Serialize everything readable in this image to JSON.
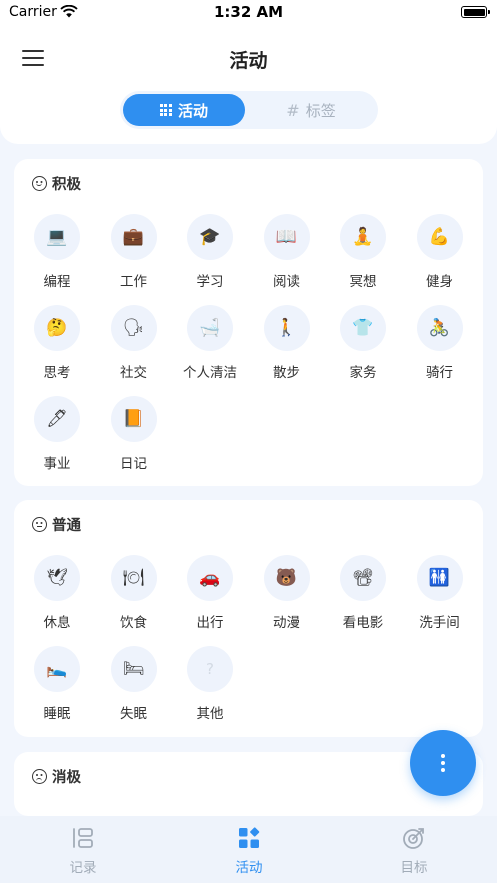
{
  "status_bar": {
    "carrier": "Carrier",
    "time": "1:32 AM"
  },
  "header": {
    "title": "活动",
    "segments": [
      {
        "label": "活动",
        "active": true,
        "icon": "grid-icon"
      },
      {
        "label": "标签",
        "active": false,
        "icon": "hash-icon"
      }
    ]
  },
  "sections": [
    {
      "title": "积极",
      "mood_icon": "smile-face-icon",
      "items": [
        {
          "label": "编程",
          "emoji": "💻",
          "name": "laptop-icon"
        },
        {
          "label": "工作",
          "emoji": "💼",
          "name": "briefcase-icon"
        },
        {
          "label": "学习",
          "emoji": "🎓",
          "name": "graduation-cap-icon"
        },
        {
          "label": "阅读",
          "emoji": "📖",
          "name": "book-icon"
        },
        {
          "label": "冥想",
          "emoji": "🧘",
          "name": "meditation-icon"
        },
        {
          "label": "健身",
          "emoji": "💪",
          "name": "flexed-biceps-icon"
        },
        {
          "label": "思考",
          "emoji": "🤔",
          "name": "thinking-face-icon"
        },
        {
          "label": "社交",
          "emoji": "🗣",
          "name": "speaking-head-icon"
        },
        {
          "label": "个人清洁",
          "emoji": "🛁",
          "name": "bathtub-icon"
        },
        {
          "label": "散步",
          "emoji": "🚶",
          "name": "walking-person-icon"
        },
        {
          "label": "家务",
          "emoji": "👕",
          "name": "tshirt-icon"
        },
        {
          "label": "骑行",
          "emoji": "🚴",
          "name": "cyclist-icon"
        },
        {
          "label": "事业",
          "emoji": "🖊",
          "name": "pen-icon"
        },
        {
          "label": "日记",
          "emoji": "📙",
          "name": "notebook-icon"
        }
      ]
    },
    {
      "title": "普通",
      "mood_icon": "neutral-face-icon",
      "items": [
        {
          "label": "休息",
          "emoji": "🕊",
          "name": "dove-icon"
        },
        {
          "label": "饮食",
          "emoji": "🍽",
          "name": "plate-icon"
        },
        {
          "label": "出行",
          "emoji": "🚗",
          "name": "car-icon"
        },
        {
          "label": "动漫",
          "emoji": "🐻",
          "name": "bear-face-icon"
        },
        {
          "label": "看电影",
          "emoji": "📽",
          "name": "film-projector-icon"
        },
        {
          "label": "洗手间",
          "emoji": "🚻",
          "name": "restroom-icon"
        },
        {
          "label": "睡眠",
          "emoji": "🛌",
          "name": "bed-icon"
        },
        {
          "label": "失眠",
          "emoji": "🛏",
          "name": "empty-bed-icon"
        },
        {
          "label": "其他",
          "emoji": "?",
          "name": "question-mark-icon"
        }
      ]
    },
    {
      "title": "消极",
      "mood_icon": "sad-face-icon",
      "items": []
    }
  ],
  "tabbar": [
    {
      "label": "记录",
      "active": false,
      "icon": "records-list-icon"
    },
    {
      "label": "活动",
      "active": true,
      "icon": "activity-grid-icon"
    },
    {
      "label": "目标",
      "active": false,
      "icon": "target-icon"
    }
  ],
  "colors": {
    "accent": "#2f8ff0",
    "background": "#f2f6fd",
    "icon_circle": "#eef3fc"
  }
}
